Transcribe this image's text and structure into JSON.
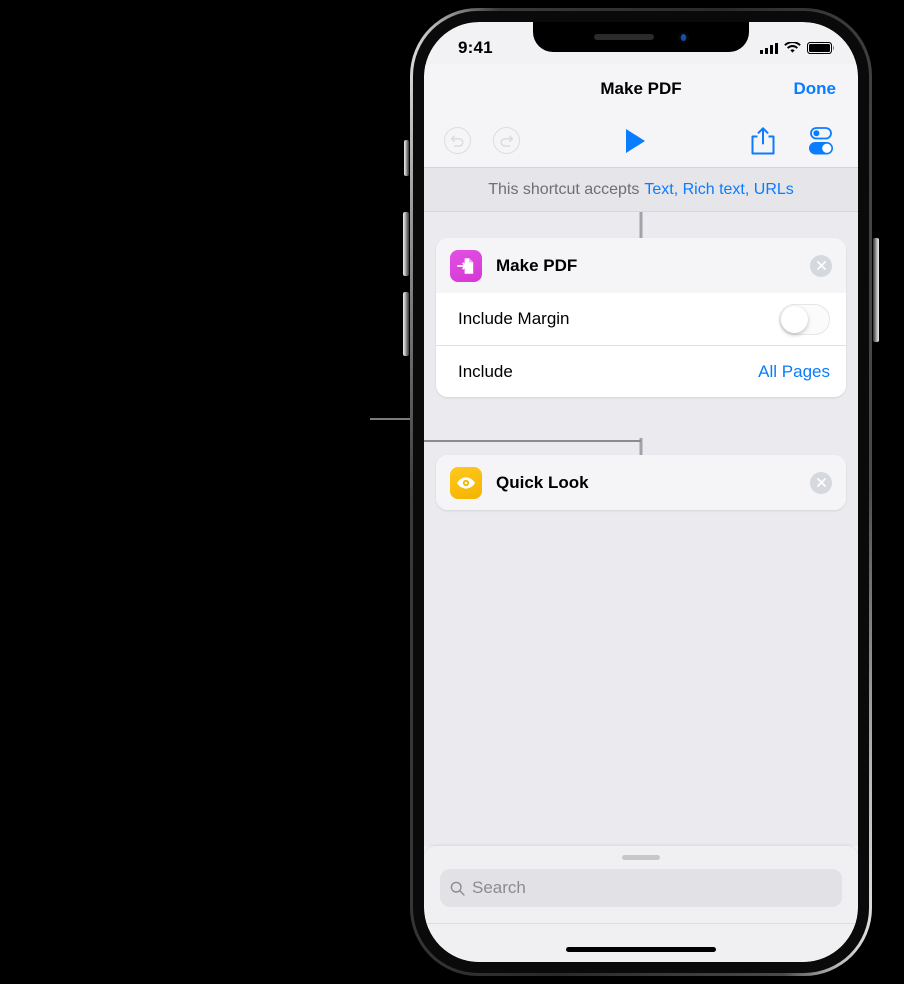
{
  "status_bar": {
    "time": "9:41",
    "cellular_icon": "signal-bars-icon",
    "wifi_icon": "wifi-icon",
    "battery_icon": "battery-icon"
  },
  "nav_bar": {
    "title": "Make PDF",
    "done_label": "Done"
  },
  "toolbar": {
    "undo_icon": "undo-icon",
    "redo_icon": "redo-icon",
    "run_icon": "play-icon",
    "share_icon": "share-icon",
    "settings_icon": "toggles-icon"
  },
  "accepts_bar": {
    "prefix": "This shortcut accepts",
    "types": "Text, Rich text, URLs"
  },
  "actions": [
    {
      "title": "Make PDF",
      "icon": "make-pdf-icon",
      "icon_color": "#d637d6",
      "remove_label": "×",
      "parameters": [
        {
          "label": "Include Margin",
          "type": "switch",
          "value": "off"
        },
        {
          "label": "Include",
          "type": "select",
          "value": "All Pages"
        }
      ]
    },
    {
      "title": "Quick Look",
      "icon": "quick-look-icon",
      "icon_color": "#f5b300",
      "remove_label": "×",
      "parameters": []
    }
  ],
  "search": {
    "placeholder": "Search",
    "icon": "search-icon"
  },
  "colors": {
    "accent_blue": "#0a7cff",
    "screen_bg": "#ebebef",
    "card_bg": "#ffffff",
    "chrome_bg": "#f5f5f7"
  }
}
